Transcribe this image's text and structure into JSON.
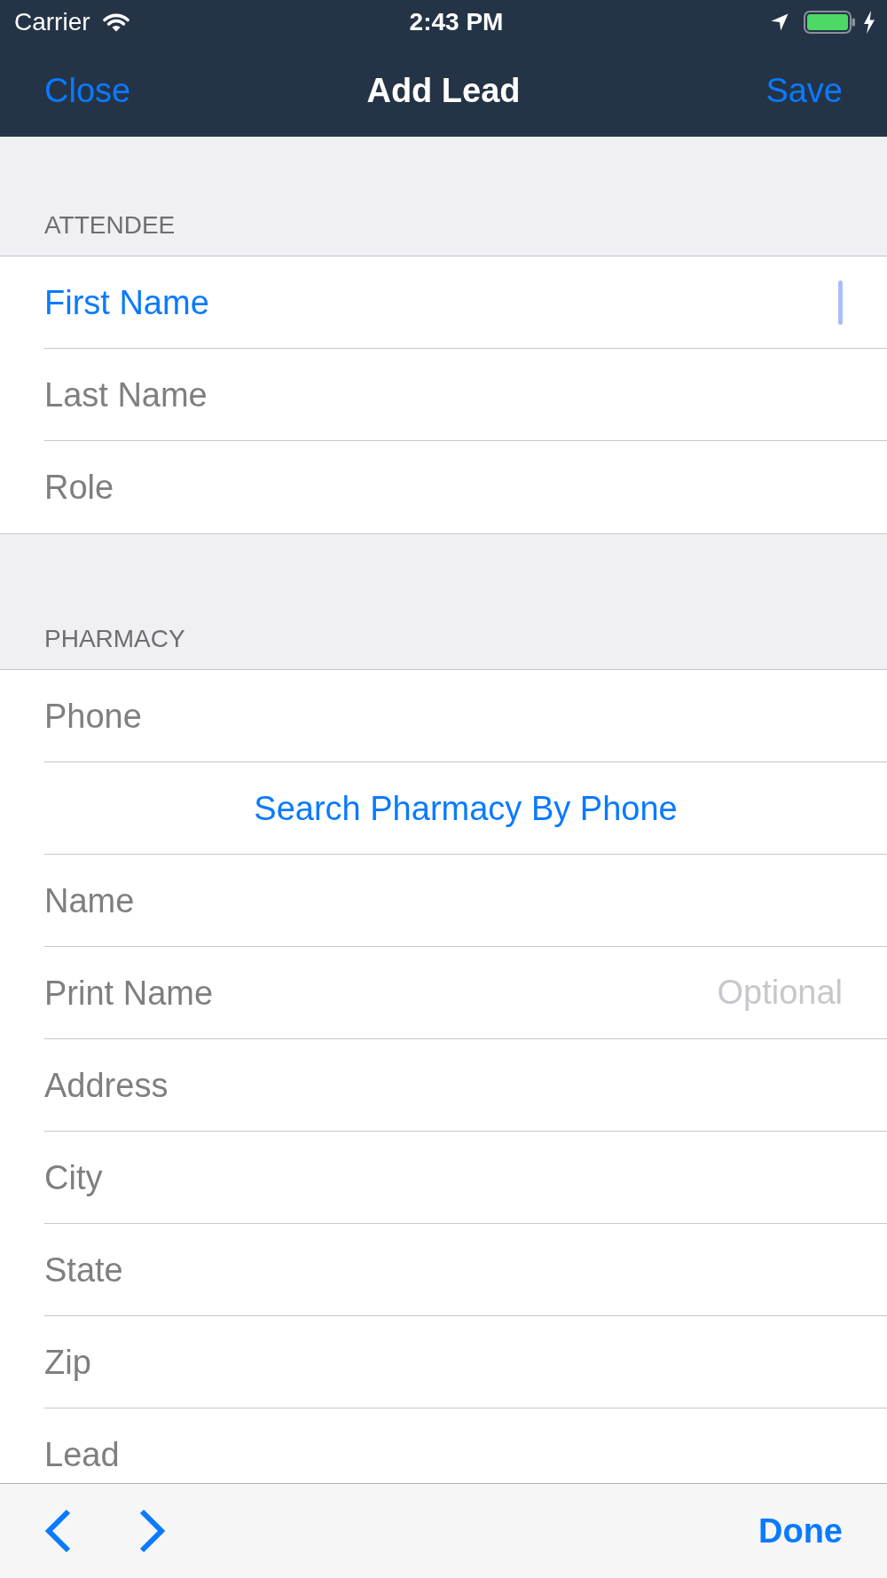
{
  "status_bar": {
    "carrier": "Carrier",
    "time": "2:43 PM"
  },
  "navigation_bar": {
    "left_button": "Close",
    "title": "Add Lead",
    "right_button": "Save"
  },
  "sections": [
    {
      "header": "ATTENDEE",
      "rows": [
        {
          "kind": "field",
          "label": "First Name",
          "focused": true
        },
        {
          "kind": "field",
          "label": "Last Name",
          "focused": false
        },
        {
          "kind": "field",
          "label": "Role",
          "focused": false
        }
      ]
    },
    {
      "header": "PHARMACY",
      "rows": [
        {
          "kind": "field",
          "label": "Phone",
          "focused": false
        },
        {
          "kind": "action",
          "label": "Search Pharmacy By Phone"
        },
        {
          "kind": "field",
          "label": "Name",
          "focused": false
        },
        {
          "kind": "field",
          "label": "Print Name",
          "focused": false,
          "placeholder": "Optional"
        },
        {
          "kind": "field",
          "label": "Address",
          "focused": false
        },
        {
          "kind": "field",
          "label": "City",
          "focused": false
        },
        {
          "kind": "field",
          "label": "State",
          "focused": false
        },
        {
          "kind": "field",
          "label": "Zip",
          "focused": false
        },
        {
          "kind": "field",
          "label": "Lead",
          "focused": false
        }
      ]
    }
  ],
  "keyboard_toolbar": {
    "done_button": "Done"
  }
}
